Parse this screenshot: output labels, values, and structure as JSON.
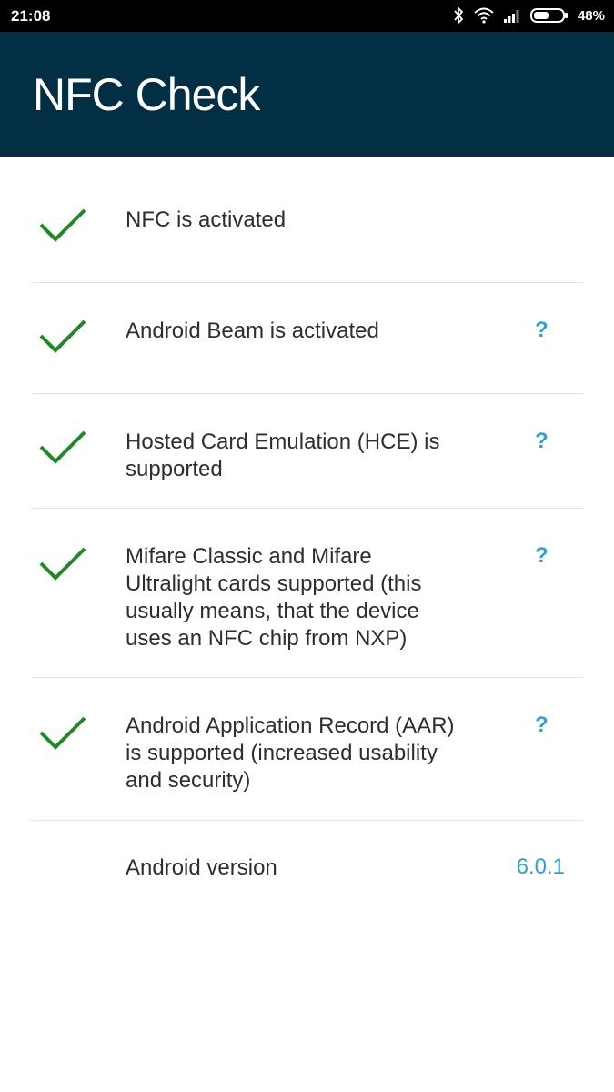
{
  "status_bar": {
    "time": "21:08",
    "battery_percent": "48%",
    "icons": [
      "bluetooth-icon",
      "wifi-icon",
      "signal-icon",
      "battery-icon"
    ]
  },
  "app_bar": {
    "title": "NFC Check",
    "color": "#032f44"
  },
  "checks": [
    {
      "label": "NFC is activated",
      "status": "ok",
      "help": ""
    },
    {
      "label": "Android Beam is activated",
      "status": "ok",
      "help": "?"
    },
    {
      "label": "Hosted Card Emulation (HCE) is supported",
      "status": "ok",
      "help": "?"
    },
    {
      "label": "Mifare Classic and Mifare Ultralight cards supported (this usually means, that the device uses an NFC chip from NXP)",
      "status": "ok",
      "help": "?"
    },
    {
      "label": "Android Application Record (AAR) is supported (increased usability and security)",
      "status": "ok",
      "help": "?"
    }
  ],
  "android_version": {
    "label": "Android version",
    "value": "6.0.1"
  },
  "colors": {
    "check": "#1e8a22",
    "link": "#2aa2d8"
  }
}
